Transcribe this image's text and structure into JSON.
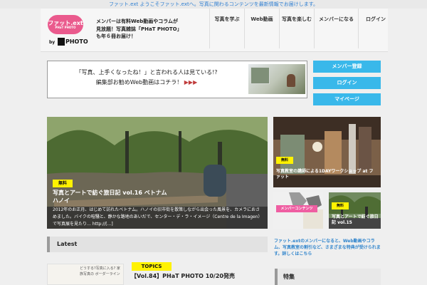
{
  "topbar": {
    "text": "ファット.ext ようこそファット.extへ。写真に関わるコンテンツを最新情報でお届けします。"
  },
  "header": {
    "logo_text": "ファット.ext",
    "logo_sub": "PHaT PHOTO",
    "by_label": "by",
    "photo_label": "PHOTO",
    "tagline": "メンバーは有料Web動画やコラムが見放題！写真雑誌「PHaT PHOTO」も年６冊お届け！",
    "nav": [
      "写真を学ぶ",
      "Web動画",
      "写真を楽しむ",
      "メンバーになる",
      "ログイン"
    ]
  },
  "banner": {
    "line1": "「写真、上手くなったね！」と言われる人は見ている!?",
    "line2": "編集部お勧めWeb動画はコチラ！",
    "arrows": "▶▶▶"
  },
  "sidebar_buttons": [
    "メンバー登録",
    "ログイン",
    "マイページ"
  ],
  "hero": {
    "badge": "無料",
    "title": "写真とアートで紡ぐ旅日記 vol.16 ベトナム　ハノイ",
    "text": "2012年のお正月、はじめて訪れたベトナム。ハノイの旧市街を散策しながら出会った風景を、カメラにおさめました。バイクの喧騒と、静かな路地のあいだで、センター・デ・ラ・イメージ（Centre de la Imagen）で写真展を見たり… http://[...]"
  },
  "cards": {
    "top": {
      "badge": "無料",
      "title": "写真教室の講師による1DAYワークショップ at ファット"
    },
    "bottom_left": {
      "badge": "メンバーコンテンツ",
      "title": ""
    },
    "bottom_right": {
      "badge": "無料",
      "title": "写真とアートで紡ぐ旅日記 vol.15"
    }
  },
  "latest": {
    "label": "Latest"
  },
  "article": {
    "topic_badge": "TOPICS",
    "title": "【Vol.84】PHaT PHOTO 10/20発売",
    "thumb_headline": "どうする?写真に入る? 家族写真の ボーダーライン"
  },
  "side_info": "ファット.extのメンバーになると、Web動画やコラム、写真教室の割引など、さまざまな特典が受けられます。詳しくはこちら",
  "side_box": {
    "label": "特集"
  }
}
